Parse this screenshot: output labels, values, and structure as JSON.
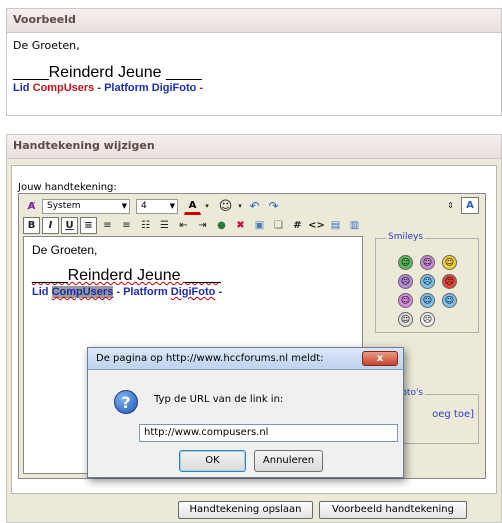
{
  "preview": {
    "title": "Voorbeeld",
    "greeting": "De Groeten,",
    "name": "____Reinderd Jeune ____",
    "line_lid": "Lid ",
    "line_compusers": "CompUsers",
    "line_sep1": " - ",
    "line_platform": "Platform DigiFoto",
    "line_sep2": " -"
  },
  "edit": {
    "title": "Handtekening wijzigen",
    "label": "Jouw handtekening:",
    "toolbar": {
      "font_family": "System",
      "font_size": "4",
      "bold": "B",
      "italic": "I",
      "underline": "U",
      "hash": "#",
      "code": "<>"
    },
    "content": {
      "greeting": "De Groeten,",
      "name": "____Reinderd Jeune ____",
      "lid": "Lid ",
      "compusers": "CompUsers",
      "sep1": " - ",
      "platform": "Platform ",
      "digifoto": "DigiFoto",
      "sep2": " -"
    },
    "smileys_label": "Smileys",
    "fotos_label": "n Foto's",
    "fotos_text": "oeg toe]",
    "save_button": "Handtekening opslaan",
    "preview_button": "Voorbeeld handtekening"
  },
  "dialog": {
    "title": "De pagina op http://www.hccforums.nl meldt:",
    "close": "x",
    "message": "Typ de URL van de link in:",
    "input_value": "http://www.compusers.nl",
    "ok": "OK",
    "cancel": "Annuleren"
  },
  "colors": {
    "accent_blue": "#1a2db0",
    "accent_red": "#c0141c"
  }
}
